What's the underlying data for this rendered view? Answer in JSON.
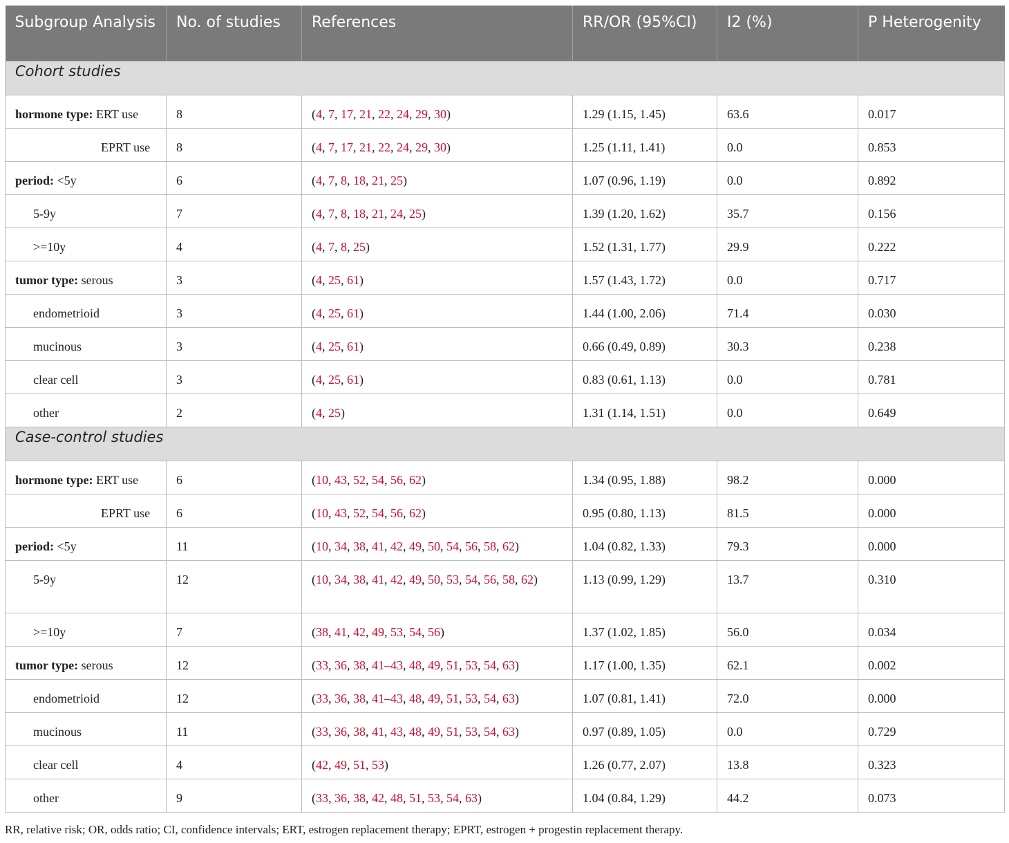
{
  "headers": [
    "Subgroup Analysis",
    "No. of studies",
    "References",
    "RR/OR (95%CI)",
    "I2 (%)",
    "P Heterogenity"
  ],
  "sections": [
    {
      "title": "Cohort studies",
      "rows": [
        {
          "group": "hormone type:",
          "label": "ERT use",
          "n": "8",
          "refs": [
            "4",
            "7",
            "17",
            "21",
            "22",
            "24",
            "29",
            "30"
          ],
          "rr": "1.29 (1.15, 1.45)",
          "i2": "63.6",
          "p": "0.017"
        },
        {
          "group": "",
          "label": "EPRT use",
          "n": "8",
          "refs": [
            "4",
            "7",
            "17",
            "21",
            "22",
            "24",
            "29",
            "30"
          ],
          "rr": "1.25 (1.11, 1.41)",
          "i2": "0.0",
          "p": "0.853"
        },
        {
          "group": "period:",
          "label": "<5y",
          "n": "6",
          "refs": [
            "4",
            "7",
            "8",
            "18",
            "21",
            "25"
          ],
          "rr": "1.07 (0.96, 1.19)",
          "i2": "0.0",
          "p": "0.892"
        },
        {
          "group": "",
          "label": "5-9y",
          "n": "7",
          "refs": [
            "4",
            "7",
            "8",
            "18",
            "21",
            "24",
            "25"
          ],
          "rr": "1.39 (1.20, 1.62)",
          "i2": "35.7",
          "p": "0.156"
        },
        {
          "group": "",
          "label": ">=10y",
          "n": "4",
          "refs": [
            "4",
            "7",
            "8",
            "25"
          ],
          "rr": "1.52 (1.31, 1.77)",
          "i2": "29.9",
          "p": "0.222"
        },
        {
          "group": "tumor type:",
          "label": "serous",
          "n": "3",
          "refs": [
            "4",
            "25",
            "61"
          ],
          "rr": "1.57 (1.43, 1.72)",
          "i2": "0.0",
          "p": "0.717"
        },
        {
          "group": "",
          "label": "endometrioid",
          "n": "3",
          "refs": [
            "4",
            "25",
            "61"
          ],
          "rr": "1.44 (1.00, 2.06)",
          "i2": "71.4",
          "p": "0.030"
        },
        {
          "group": "",
          "label": "mucinous",
          "n": "3",
          "refs": [
            "4",
            "25",
            "61"
          ],
          "rr": "0.66 (0.49, 0.89)",
          "i2": "30.3",
          "p": "0.238"
        },
        {
          "group": "",
          "label": "clear cell",
          "n": "3",
          "refs": [
            "4",
            "25",
            "61"
          ],
          "rr": "0.83 (0.61, 1.13)",
          "i2": "0.0",
          "p": "0.781"
        },
        {
          "group": "",
          "label": "other",
          "n": "2",
          "refs": [
            "4",
            "25"
          ],
          "rr": "1.31 (1.14, 1.51)",
          "i2": "0.0",
          "p": "0.649"
        }
      ]
    },
    {
      "title": "Case-control studies",
      "rows": [
        {
          "group": "hormone type:",
          "label": "ERT use",
          "n": "6",
          "refs": [
            "10",
            "43",
            "52",
            "54",
            "56",
            "62"
          ],
          "rr": "1.34 (0.95, 1.88)",
          "i2": "98.2",
          "p": "0.000"
        },
        {
          "group": "",
          "label": "EPRT use",
          "n": "6",
          "refs": [
            "10",
            "43",
            "52",
            "54",
            "56",
            "62"
          ],
          "rr": "0.95 (0.80, 1.13)",
          "i2": "81.5",
          "p": "0.000"
        },
        {
          "group": "period:",
          "label": "<5y",
          "n": "11",
          "refs": [
            "10",
            "34",
            "38",
            "41",
            "42",
            "49",
            "50",
            "54",
            "56",
            "58",
            "62"
          ],
          "rr": "1.04 (0.82, 1.33)",
          "i2": "79.3",
          "p": "0.000"
        },
        {
          "group": "",
          "label": "5-9y",
          "n": "12",
          "refs": [
            "10",
            "34",
            "38",
            "41",
            "42",
            "49",
            "50",
            "53",
            "54",
            "56",
            "58",
            "62"
          ],
          "rr": "1.13 (0.99, 1.29)",
          "i2": "13.7",
          "p": "0.310"
        },
        {
          "group": "",
          "label": ">=10y",
          "n": "7",
          "refs": [
            "38",
            "41",
            "42",
            "49",
            "53",
            "54",
            "56"
          ],
          "rr": "1.37 (1.02, 1.85)",
          "i2": "56.0",
          "p": "0.034"
        },
        {
          "group": "tumor type:",
          "label": "serous",
          "n": "12",
          "refs": [
            "33",
            "36",
            "38",
            "41–43",
            "48",
            "49",
            "51",
            "53",
            "54",
            "63"
          ],
          "rr": "1.17 (1.00, 1.35)",
          "i2": "62.1",
          "p": "0.002"
        },
        {
          "group": "",
          "label": "endometrioid",
          "n": "12",
          "refs": [
            "33",
            "36",
            "38",
            "41–43",
            "48",
            "49",
            "51",
            "53",
            "54",
            "63"
          ],
          "rr": "1.07 (0.81, 1.41)",
          "i2": "72.0",
          "p": "0.000"
        },
        {
          "group": "",
          "label": "mucinous",
          "n": "11",
          "refs": [
            "33",
            "36",
            "38",
            "41",
            "43",
            "48",
            "49",
            "51",
            "53",
            "54",
            "63"
          ],
          "rr": "0.97 (0.89, 1.05)",
          "i2": "0.0",
          "p": "0.729"
        },
        {
          "group": "",
          "label": "clear cell",
          "n": "4",
          "refs": [
            "42",
            "49",
            "51",
            "53"
          ],
          "rr": "1.26 (0.77, 2.07)",
          "i2": "13.8",
          "p": "0.323"
        },
        {
          "group": "",
          "label": "other",
          "n": "9",
          "refs": [
            "33",
            "36",
            "38",
            "42",
            "48",
            "51",
            "53",
            "54",
            "63"
          ],
          "rr": "1.04 (0.84, 1.29)",
          "i2": "44.2",
          "p": "0.073"
        }
      ]
    }
  ],
  "footnote": "RR, relative risk; OR, odds ratio; CI, confidence intervals; ERT, estrogen replacement therapy; EPRT, estrogen + progestin replacement therapy."
}
